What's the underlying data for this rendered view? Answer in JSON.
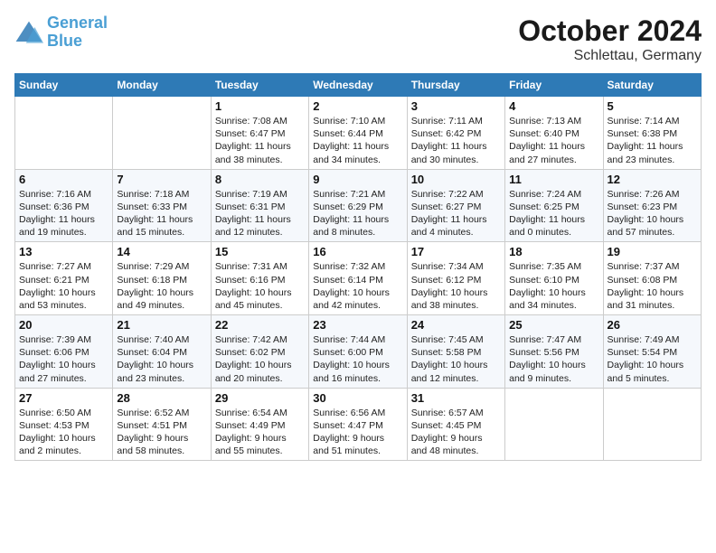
{
  "header": {
    "logo_line1": "General",
    "logo_line2": "Blue",
    "month": "October 2024",
    "location": "Schlettau, Germany"
  },
  "weekdays": [
    "Sunday",
    "Monday",
    "Tuesday",
    "Wednesday",
    "Thursday",
    "Friday",
    "Saturday"
  ],
  "weeks": [
    [
      {
        "day": "",
        "info": ""
      },
      {
        "day": "",
        "info": ""
      },
      {
        "day": "1",
        "info": "Sunrise: 7:08 AM\nSunset: 6:47 PM\nDaylight: 11 hours\nand 38 minutes."
      },
      {
        "day": "2",
        "info": "Sunrise: 7:10 AM\nSunset: 6:44 PM\nDaylight: 11 hours\nand 34 minutes."
      },
      {
        "day": "3",
        "info": "Sunrise: 7:11 AM\nSunset: 6:42 PM\nDaylight: 11 hours\nand 30 minutes."
      },
      {
        "day": "4",
        "info": "Sunrise: 7:13 AM\nSunset: 6:40 PM\nDaylight: 11 hours\nand 27 minutes."
      },
      {
        "day": "5",
        "info": "Sunrise: 7:14 AM\nSunset: 6:38 PM\nDaylight: 11 hours\nand 23 minutes."
      }
    ],
    [
      {
        "day": "6",
        "info": "Sunrise: 7:16 AM\nSunset: 6:36 PM\nDaylight: 11 hours\nand 19 minutes."
      },
      {
        "day": "7",
        "info": "Sunrise: 7:18 AM\nSunset: 6:33 PM\nDaylight: 11 hours\nand 15 minutes."
      },
      {
        "day": "8",
        "info": "Sunrise: 7:19 AM\nSunset: 6:31 PM\nDaylight: 11 hours\nand 12 minutes."
      },
      {
        "day": "9",
        "info": "Sunrise: 7:21 AM\nSunset: 6:29 PM\nDaylight: 11 hours\nand 8 minutes."
      },
      {
        "day": "10",
        "info": "Sunrise: 7:22 AM\nSunset: 6:27 PM\nDaylight: 11 hours\nand 4 minutes."
      },
      {
        "day": "11",
        "info": "Sunrise: 7:24 AM\nSunset: 6:25 PM\nDaylight: 11 hours\nand 0 minutes."
      },
      {
        "day": "12",
        "info": "Sunrise: 7:26 AM\nSunset: 6:23 PM\nDaylight: 10 hours\nand 57 minutes."
      }
    ],
    [
      {
        "day": "13",
        "info": "Sunrise: 7:27 AM\nSunset: 6:21 PM\nDaylight: 10 hours\nand 53 minutes."
      },
      {
        "day": "14",
        "info": "Sunrise: 7:29 AM\nSunset: 6:18 PM\nDaylight: 10 hours\nand 49 minutes."
      },
      {
        "day": "15",
        "info": "Sunrise: 7:31 AM\nSunset: 6:16 PM\nDaylight: 10 hours\nand 45 minutes."
      },
      {
        "day": "16",
        "info": "Sunrise: 7:32 AM\nSunset: 6:14 PM\nDaylight: 10 hours\nand 42 minutes."
      },
      {
        "day": "17",
        "info": "Sunrise: 7:34 AM\nSunset: 6:12 PM\nDaylight: 10 hours\nand 38 minutes."
      },
      {
        "day": "18",
        "info": "Sunrise: 7:35 AM\nSunset: 6:10 PM\nDaylight: 10 hours\nand 34 minutes."
      },
      {
        "day": "19",
        "info": "Sunrise: 7:37 AM\nSunset: 6:08 PM\nDaylight: 10 hours\nand 31 minutes."
      }
    ],
    [
      {
        "day": "20",
        "info": "Sunrise: 7:39 AM\nSunset: 6:06 PM\nDaylight: 10 hours\nand 27 minutes."
      },
      {
        "day": "21",
        "info": "Sunrise: 7:40 AM\nSunset: 6:04 PM\nDaylight: 10 hours\nand 23 minutes."
      },
      {
        "day": "22",
        "info": "Sunrise: 7:42 AM\nSunset: 6:02 PM\nDaylight: 10 hours\nand 20 minutes."
      },
      {
        "day": "23",
        "info": "Sunrise: 7:44 AM\nSunset: 6:00 PM\nDaylight: 10 hours\nand 16 minutes."
      },
      {
        "day": "24",
        "info": "Sunrise: 7:45 AM\nSunset: 5:58 PM\nDaylight: 10 hours\nand 12 minutes."
      },
      {
        "day": "25",
        "info": "Sunrise: 7:47 AM\nSunset: 5:56 PM\nDaylight: 10 hours\nand 9 minutes."
      },
      {
        "day": "26",
        "info": "Sunrise: 7:49 AM\nSunset: 5:54 PM\nDaylight: 10 hours\nand 5 minutes."
      }
    ],
    [
      {
        "day": "27",
        "info": "Sunrise: 6:50 AM\nSunset: 4:53 PM\nDaylight: 10 hours\nand 2 minutes."
      },
      {
        "day": "28",
        "info": "Sunrise: 6:52 AM\nSunset: 4:51 PM\nDaylight: 9 hours\nand 58 minutes."
      },
      {
        "day": "29",
        "info": "Sunrise: 6:54 AM\nSunset: 4:49 PM\nDaylight: 9 hours\nand 55 minutes."
      },
      {
        "day": "30",
        "info": "Sunrise: 6:56 AM\nSunset: 4:47 PM\nDaylight: 9 hours\nand 51 minutes."
      },
      {
        "day": "31",
        "info": "Sunrise: 6:57 AM\nSunset: 4:45 PM\nDaylight: 9 hours\nand 48 minutes."
      },
      {
        "day": "",
        "info": ""
      },
      {
        "day": "",
        "info": ""
      }
    ]
  ]
}
